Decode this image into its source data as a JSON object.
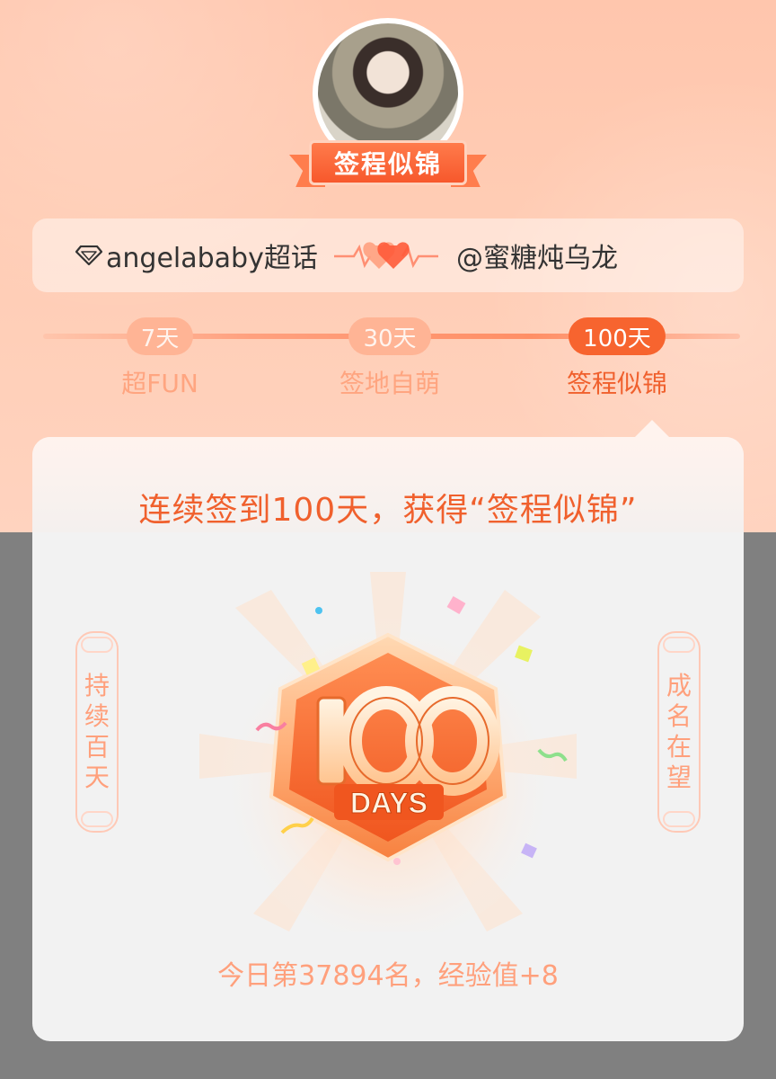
{
  "badge": {
    "title": "签程似锦"
  },
  "pair": {
    "left_label": "angelababy超话",
    "right_label": "@蜜糖炖乌龙"
  },
  "milestones": [
    {
      "days": "7天",
      "label": "超FUN"
    },
    {
      "days": "30天",
      "label": "签地自萌"
    },
    {
      "days": "100天",
      "label": "签程似锦"
    }
  ],
  "card": {
    "title": "连续签到100天，获得“签程似锦”",
    "left_motto": [
      "持",
      "续",
      "百",
      "天"
    ],
    "right_motto": [
      "成",
      "名",
      "在",
      "望"
    ],
    "medal_number": "100",
    "medal_caption": "DAYS",
    "rank_text": "今日第37894名，经验值+8"
  },
  "colors": {
    "accent": "#f7642f",
    "accent_light": "#ffb495",
    "title_orange": "#f0602d",
    "muted_orange": "#ffa07c"
  },
  "icons": {
    "topic": "diamond-icon",
    "link": "heartbeat-hearts-icon"
  }
}
